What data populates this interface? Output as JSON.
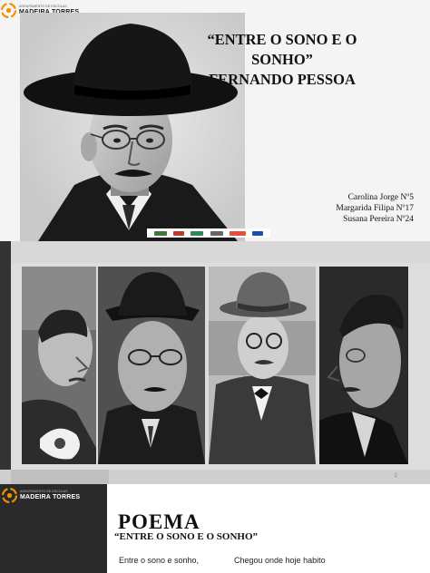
{
  "logo": {
    "small_text": "AGRUPAMENTO DE ESCOLAS",
    "name": "MADEIRA TORRES",
    "color": "#f29100"
  },
  "slide1": {
    "title_line1": "“ENTRE O SONO E O SONHO”",
    "title_line2": "FERNANDO PESSOA",
    "authors": [
      "Carolina Jorge Nº5",
      "Margarida Filipa Nº17",
      "Susana Pereira Nº24"
    ],
    "funding_logos": [
      "sponsor-logo",
      "sponsor-logo",
      "sponsor-logo",
      "sponsor-logo",
      "portugal-2020-logo",
      "eu-flag"
    ]
  },
  "slide2": {
    "page_number": "2",
    "photos": [
      "portrait-young-man",
      "portrait-glasses-man",
      "portrait-hat-man",
      "portrait-profile-man"
    ]
  },
  "slide3": {
    "heading": "POEMA",
    "poem_title": "“ENTRE O SONO E O SONHO”",
    "col1_line1": "Entre o sono e sonho,",
    "col2_line1": "Chegou onde hoje habito"
  }
}
